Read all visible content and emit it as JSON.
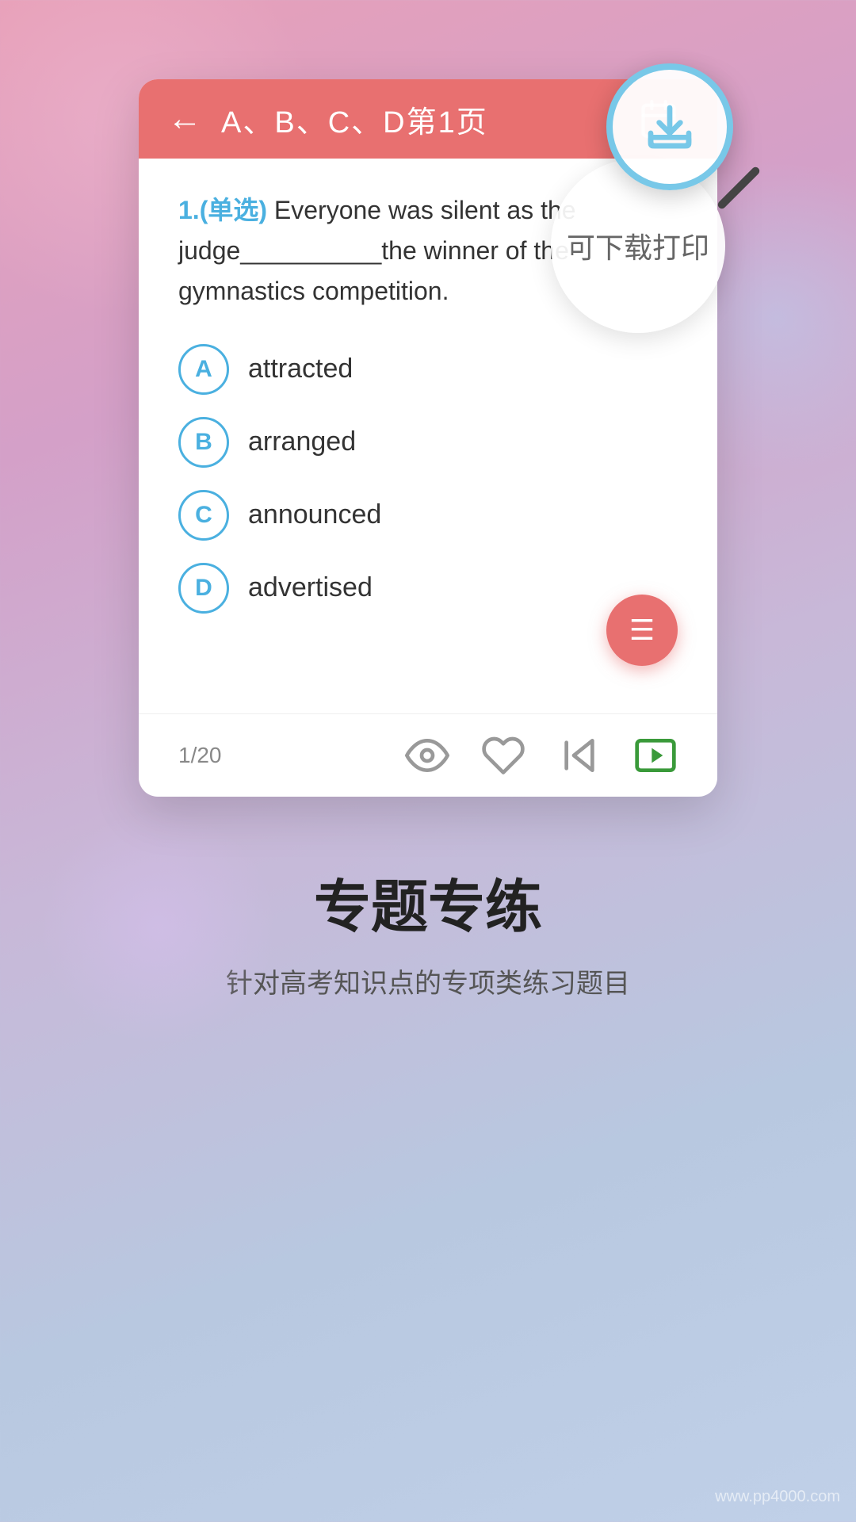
{
  "background": {
    "color_start": "#e8a0b8",
    "color_end": "#c0d0e8"
  },
  "card": {
    "header": {
      "back_label": "←",
      "title": "A、B、C、D第1页",
      "calendar_icon": "calendar-icon",
      "download_icon": "download-icon"
    },
    "magnifier": {
      "tooltip_text": "可下载打印"
    },
    "question": {
      "number": "1.",
      "type": "(单选)",
      "text": " Everyone was silent as the judge__________the winner of the gymnastics competition."
    },
    "options": [
      {
        "letter": "A",
        "text": "attracted"
      },
      {
        "letter": "B",
        "text": "arranged"
      },
      {
        "letter": "C",
        "text": "announced"
      },
      {
        "letter": "D",
        "text": "advertised"
      }
    ],
    "footer": {
      "page_indicator": "1/20"
    }
  },
  "bottom": {
    "title": "专题专练",
    "subtitle": "针对高考知识点的专项类练习题目"
  },
  "watermark": "www.pp4000.com"
}
